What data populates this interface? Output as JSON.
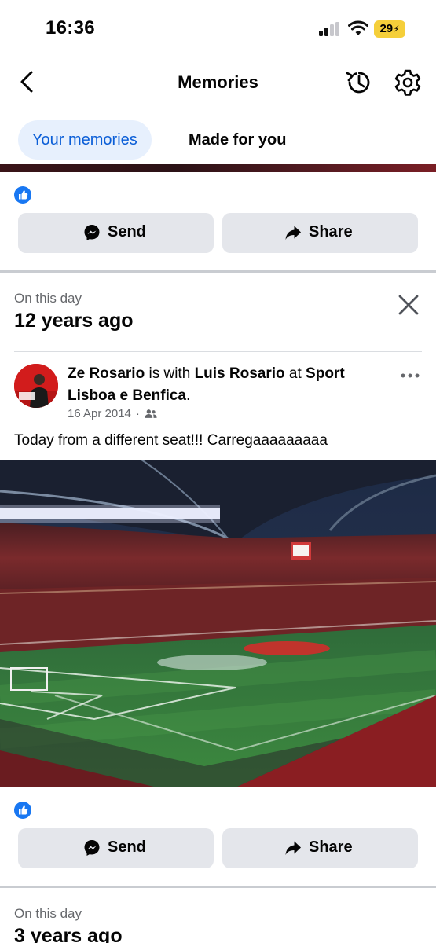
{
  "status_bar": {
    "time": "16:36",
    "battery": "29"
  },
  "header": {
    "title": "Memories"
  },
  "tabs": [
    {
      "label": "Your memories",
      "active": true
    },
    {
      "label": "Made for you",
      "active": false
    }
  ],
  "actions": {
    "send_label": "Send",
    "share_label": "Share"
  },
  "memory1": {
    "section_label": "On this day",
    "years_ago": "12 years ago",
    "post": {
      "author": "Ze Rosario",
      "connector1": " is with ",
      "tagged": "Luis Rosario",
      "connector2": " at ",
      "place": "Sport Lisboa e Benfica",
      "end": ".",
      "date": "16 Apr 2014",
      "separator": "·",
      "text": "Today from a different seat!!! Carregaaaaaaaaa"
    }
  },
  "memory2": {
    "section_label": "On this day",
    "years_ago": "3 years ago"
  },
  "colors": {
    "accent_blue": "#1877f2",
    "tab_active_bg": "#e7f0fd",
    "tab_active_text": "#0b5ed7",
    "button_bg": "#e4e6eb",
    "battery_yellow": "#f5cf3a"
  },
  "icons": {
    "back": "chevron-left-icon",
    "history": "history-clock-icon",
    "settings": "gear-icon",
    "like": "thumbs-up-icon",
    "send": "messenger-icon",
    "share": "share-arrow-icon",
    "close": "close-icon",
    "more": "more-horizontal-icon",
    "audience": "friends-icon"
  }
}
